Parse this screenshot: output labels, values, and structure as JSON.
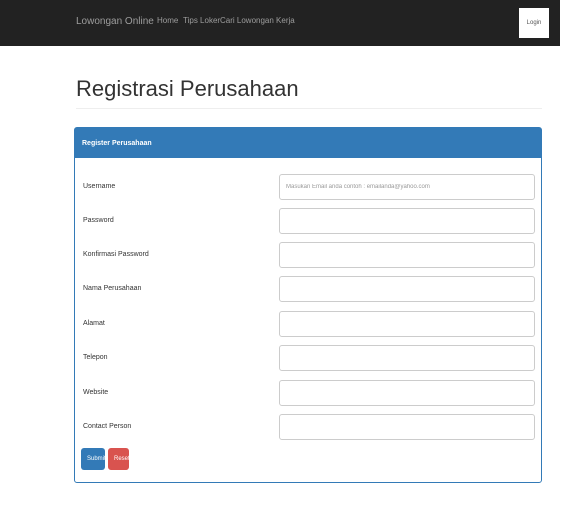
{
  "navbar": {
    "brand": "Lowongan Online",
    "links": [
      "Home",
      "Tips Loker",
      "Cari Lowongan Kerja"
    ],
    "login": "Login"
  },
  "page": {
    "title": "Registrasi Perusahaan"
  },
  "panel": {
    "heading": "Register Perusahaan"
  },
  "form": {
    "fields": [
      {
        "label": "Username",
        "placeholder": "Masukan Email anda contoh : emailanda@yahoo.com",
        "value": ""
      },
      {
        "label": "Password",
        "placeholder": "",
        "value": ""
      },
      {
        "label": "Konfirmasi Password",
        "placeholder": "",
        "value": ""
      },
      {
        "label": "Nama Perusahaan",
        "placeholder": "",
        "value": ""
      },
      {
        "label": "Alamat",
        "placeholder": "",
        "value": ""
      },
      {
        "label": "Telepon",
        "placeholder": "",
        "value": ""
      },
      {
        "label": "Website",
        "placeholder": "",
        "value": ""
      },
      {
        "label": "Contact Person",
        "placeholder": "",
        "value": ""
      }
    ],
    "submit": "Submit",
    "reset": "Reset"
  },
  "colors": {
    "navbar": "#222222",
    "primary": "#337ab7",
    "danger": "#d9534f"
  }
}
